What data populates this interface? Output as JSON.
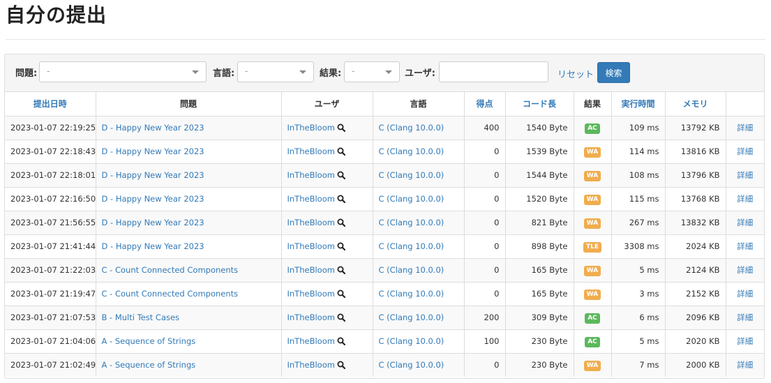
{
  "page": {
    "title": "自分の提出"
  },
  "filters": {
    "problem_label": "問題:",
    "problem_value": "-",
    "language_label": "言語:",
    "language_value": "-",
    "result_label": "結果:",
    "result_value": "-",
    "user_label": "ユーザ:",
    "user_value": "",
    "reset_label": "リセット",
    "search_label": "検索"
  },
  "colors": {
    "AC": "#5cb85c",
    "WA": "#f0ad4e",
    "TLE": "#f0ad4e",
    "link": "#337ab7"
  },
  "table": {
    "headers": {
      "date": "提出日時",
      "task": "問題",
      "user": "ユーザ",
      "lang": "言語",
      "score": "得点",
      "code_len": "コード長",
      "result": "結果",
      "time": "実行時間",
      "memory": "メモリ",
      "detail": ""
    },
    "rows": [
      {
        "date": "2023-01-07 22:19:25",
        "task": "D - Happy New Year 2023",
        "user": "InTheBloom",
        "lang": "C (Clang 10.0.0)",
        "score": "400",
        "code_len": "1540 Byte",
        "result": "AC",
        "time": "109 ms",
        "memory": "13792 KB",
        "detail": "詳細"
      },
      {
        "date": "2023-01-07 22:18:43",
        "task": "D - Happy New Year 2023",
        "user": "InTheBloom",
        "lang": "C (Clang 10.0.0)",
        "score": "0",
        "code_len": "1539 Byte",
        "result": "WA",
        "time": "114 ms",
        "memory": "13816 KB",
        "detail": "詳細"
      },
      {
        "date": "2023-01-07 22:18:01",
        "task": "D - Happy New Year 2023",
        "user": "InTheBloom",
        "lang": "C (Clang 10.0.0)",
        "score": "0",
        "code_len": "1544 Byte",
        "result": "WA",
        "time": "108 ms",
        "memory": "13796 KB",
        "detail": "詳細"
      },
      {
        "date": "2023-01-07 22:16:50",
        "task": "D - Happy New Year 2023",
        "user": "InTheBloom",
        "lang": "C (Clang 10.0.0)",
        "score": "0",
        "code_len": "1520 Byte",
        "result": "WA",
        "time": "115 ms",
        "memory": "13768 KB",
        "detail": "詳細"
      },
      {
        "date": "2023-01-07 21:56:55",
        "task": "D - Happy New Year 2023",
        "user": "InTheBloom",
        "lang": "C (Clang 10.0.0)",
        "score": "0",
        "code_len": "821 Byte",
        "result": "WA",
        "time": "267 ms",
        "memory": "13832 KB",
        "detail": "詳細"
      },
      {
        "date": "2023-01-07 21:41:44",
        "task": "D - Happy New Year 2023",
        "user": "InTheBloom",
        "lang": "C (Clang 10.0.0)",
        "score": "0",
        "code_len": "898 Byte",
        "result": "TLE",
        "time": "3308 ms",
        "memory": "2024 KB",
        "detail": "詳細"
      },
      {
        "date": "2023-01-07 21:22:03",
        "task": "C - Count Connected Components",
        "user": "InTheBloom",
        "lang": "C (Clang 10.0.0)",
        "score": "0",
        "code_len": "165 Byte",
        "result": "WA",
        "time": "5 ms",
        "memory": "2124 KB",
        "detail": "詳細"
      },
      {
        "date": "2023-01-07 21:19:47",
        "task": "C - Count Connected Components",
        "user": "InTheBloom",
        "lang": "C (Clang 10.0.0)",
        "score": "0",
        "code_len": "165 Byte",
        "result": "WA",
        "time": "3 ms",
        "memory": "2152 KB",
        "detail": "詳細"
      },
      {
        "date": "2023-01-07 21:07:53",
        "task": "B - Multi Test Cases",
        "user": "InTheBloom",
        "lang": "C (Clang 10.0.0)",
        "score": "200",
        "code_len": "309 Byte",
        "result": "AC",
        "time": "6 ms",
        "memory": "2096 KB",
        "detail": "詳細"
      },
      {
        "date": "2023-01-07 21:04:06",
        "task": "A - Sequence of Strings",
        "user": "InTheBloom",
        "lang": "C (Clang 10.0.0)",
        "score": "100",
        "code_len": "230 Byte",
        "result": "AC",
        "time": "5 ms",
        "memory": "2020 KB",
        "detail": "詳細"
      },
      {
        "date": "2023-01-07 21:02:49",
        "task": "A - Sequence of Strings",
        "user": "InTheBloom",
        "lang": "C (Clang 10.0.0)",
        "score": "0",
        "code_len": "230 Byte",
        "result": "WA",
        "time": "7 ms",
        "memory": "2000 KB",
        "detail": "詳細"
      }
    ]
  }
}
